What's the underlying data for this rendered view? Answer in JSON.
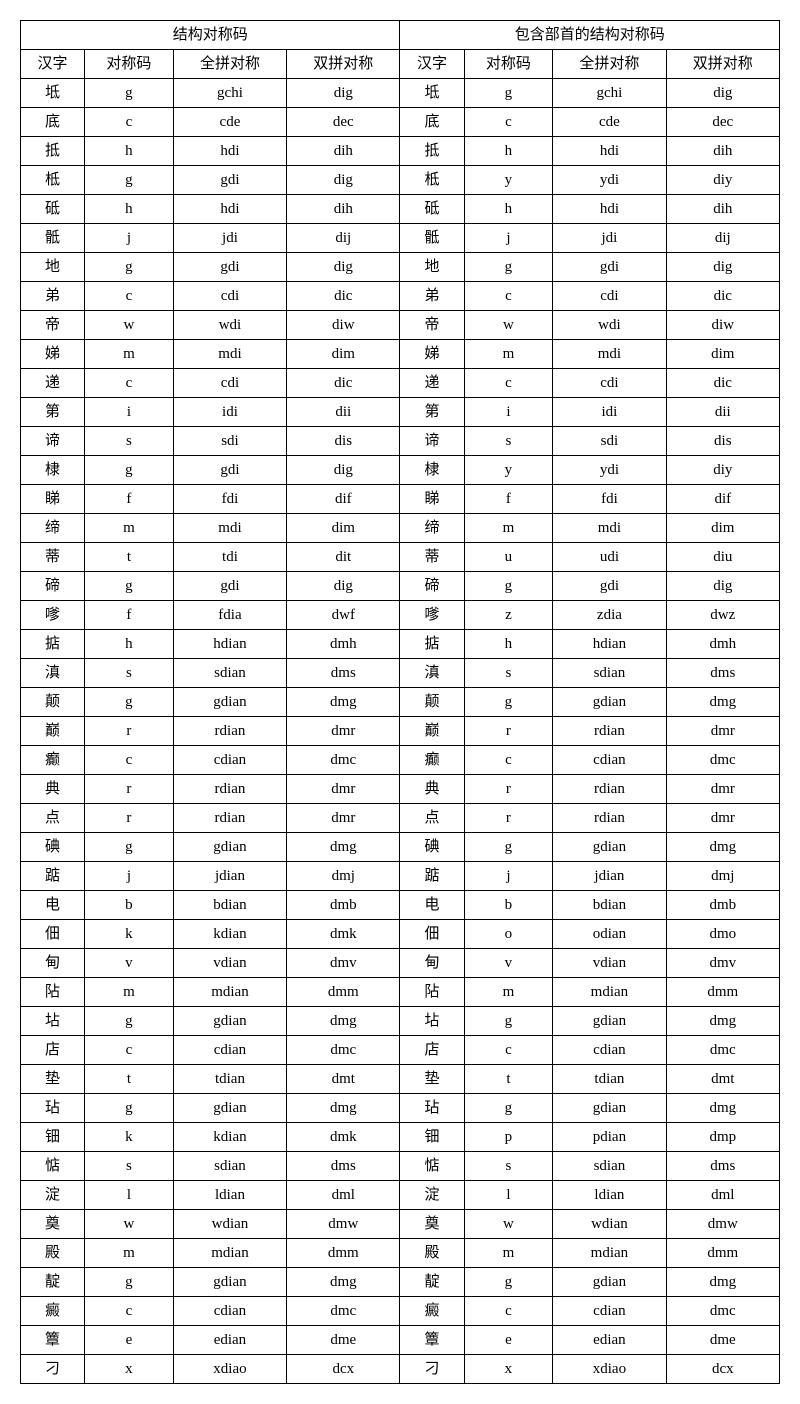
{
  "headers": {
    "group1": "结构对称码",
    "group2": "包含部首的结构对称码",
    "hanzi": "汉字",
    "duichen": "对称码",
    "quanpin": "全拼对称",
    "shuangpin": "双拼对称"
  },
  "rows": [
    {
      "l": {
        "hz": "坻",
        "dc": "g",
        "qp": "gchi",
        "sp": "dig"
      },
      "r": {
        "hz": "坻",
        "dc": "g",
        "qp": "gchi",
        "sp": "dig"
      }
    },
    {
      "l": {
        "hz": "底",
        "dc": "c",
        "qp": "cde",
        "sp": "dec"
      },
      "r": {
        "hz": "底",
        "dc": "c",
        "qp": "cde",
        "sp": "dec"
      }
    },
    {
      "l": {
        "hz": "抵",
        "dc": "h",
        "qp": "hdi",
        "sp": "dih"
      },
      "r": {
        "hz": "抵",
        "dc": "h",
        "qp": "hdi",
        "sp": "dih"
      }
    },
    {
      "l": {
        "hz": "柢",
        "dc": "g",
        "qp": "gdi",
        "sp": "dig"
      },
      "r": {
        "hz": "柢",
        "dc": "y",
        "qp": "ydi",
        "sp": "diy"
      }
    },
    {
      "l": {
        "hz": "砥",
        "dc": "h",
        "qp": "hdi",
        "sp": "dih"
      },
      "r": {
        "hz": "砥",
        "dc": "h",
        "qp": "hdi",
        "sp": "dih"
      }
    },
    {
      "l": {
        "hz": "骶",
        "dc": "j",
        "qp": "jdi",
        "sp": "dij"
      },
      "r": {
        "hz": "骶",
        "dc": "j",
        "qp": "jdi",
        "sp": "dij"
      }
    },
    {
      "l": {
        "hz": "地",
        "dc": "g",
        "qp": "gdi",
        "sp": "dig"
      },
      "r": {
        "hz": "地",
        "dc": "g",
        "qp": "gdi",
        "sp": "dig"
      }
    },
    {
      "l": {
        "hz": "弟",
        "dc": "c",
        "qp": "cdi",
        "sp": "dic"
      },
      "r": {
        "hz": "弟",
        "dc": "c",
        "qp": "cdi",
        "sp": "dic"
      }
    },
    {
      "l": {
        "hz": "帝",
        "dc": "w",
        "qp": "wdi",
        "sp": "diw"
      },
      "r": {
        "hz": "帝",
        "dc": "w",
        "qp": "wdi",
        "sp": "diw"
      }
    },
    {
      "l": {
        "hz": "娣",
        "dc": "m",
        "qp": "mdi",
        "sp": "dim"
      },
      "r": {
        "hz": "娣",
        "dc": "m",
        "qp": "mdi",
        "sp": "dim"
      }
    },
    {
      "l": {
        "hz": "递",
        "dc": "c",
        "qp": "cdi",
        "sp": "dic"
      },
      "r": {
        "hz": "递",
        "dc": "c",
        "qp": "cdi",
        "sp": "dic"
      }
    },
    {
      "l": {
        "hz": "第",
        "dc": "i",
        "qp": "idi",
        "sp": "dii"
      },
      "r": {
        "hz": "第",
        "dc": "i",
        "qp": "idi",
        "sp": "dii"
      }
    },
    {
      "l": {
        "hz": "谛",
        "dc": "s",
        "qp": "sdi",
        "sp": "dis"
      },
      "r": {
        "hz": "谛",
        "dc": "s",
        "qp": "sdi",
        "sp": "dis"
      }
    },
    {
      "l": {
        "hz": "棣",
        "dc": "g",
        "qp": "gdi",
        "sp": "dig"
      },
      "r": {
        "hz": "棣",
        "dc": "y",
        "qp": "ydi",
        "sp": "diy"
      }
    },
    {
      "l": {
        "hz": "睇",
        "dc": "f",
        "qp": "fdi",
        "sp": "dif"
      },
      "r": {
        "hz": "睇",
        "dc": "f",
        "qp": "fdi",
        "sp": "dif"
      }
    },
    {
      "l": {
        "hz": "缔",
        "dc": "m",
        "qp": "mdi",
        "sp": "dim"
      },
      "r": {
        "hz": "缔",
        "dc": "m",
        "qp": "mdi",
        "sp": "dim"
      }
    },
    {
      "l": {
        "hz": "蒂",
        "dc": "t",
        "qp": "tdi",
        "sp": "dit"
      },
      "r": {
        "hz": "蒂",
        "dc": "u",
        "qp": "udi",
        "sp": "diu"
      }
    },
    {
      "l": {
        "hz": "碲",
        "dc": "g",
        "qp": "gdi",
        "sp": "dig"
      },
      "r": {
        "hz": "碲",
        "dc": "g",
        "qp": "gdi",
        "sp": "dig"
      }
    },
    {
      "l": {
        "hz": "嗲",
        "dc": "f",
        "qp": "fdia",
        "sp": "dwf"
      },
      "r": {
        "hz": "嗲",
        "dc": "z",
        "qp": "zdia",
        "sp": "dwz"
      }
    },
    {
      "l": {
        "hz": "掂",
        "dc": "h",
        "qp": "hdian",
        "sp": "dmh"
      },
      "r": {
        "hz": "掂",
        "dc": "h",
        "qp": "hdian",
        "sp": "dmh"
      }
    },
    {
      "l": {
        "hz": "滇",
        "dc": "s",
        "qp": "sdian",
        "sp": "dms"
      },
      "r": {
        "hz": "滇",
        "dc": "s",
        "qp": "sdian",
        "sp": "dms"
      }
    },
    {
      "l": {
        "hz": "颠",
        "dc": "g",
        "qp": "gdian",
        "sp": "dmg"
      },
      "r": {
        "hz": "颠",
        "dc": "g",
        "qp": "gdian",
        "sp": "dmg"
      }
    },
    {
      "l": {
        "hz": "巅",
        "dc": "r",
        "qp": "rdian",
        "sp": "dmr"
      },
      "r": {
        "hz": "巅",
        "dc": "r",
        "qp": "rdian",
        "sp": "dmr"
      }
    },
    {
      "l": {
        "hz": "癫",
        "dc": "c",
        "qp": "cdian",
        "sp": "dmc"
      },
      "r": {
        "hz": "癫",
        "dc": "c",
        "qp": "cdian",
        "sp": "dmc"
      }
    },
    {
      "l": {
        "hz": "典",
        "dc": "r",
        "qp": "rdian",
        "sp": "dmr"
      },
      "r": {
        "hz": "典",
        "dc": "r",
        "qp": "rdian",
        "sp": "dmr"
      }
    },
    {
      "l": {
        "hz": "点",
        "dc": "r",
        "qp": "rdian",
        "sp": "dmr"
      },
      "r": {
        "hz": "点",
        "dc": "r",
        "qp": "rdian",
        "sp": "dmr"
      }
    },
    {
      "l": {
        "hz": "碘",
        "dc": "g",
        "qp": "gdian",
        "sp": "dmg"
      },
      "r": {
        "hz": "碘",
        "dc": "g",
        "qp": "gdian",
        "sp": "dmg"
      }
    },
    {
      "l": {
        "hz": "踮",
        "dc": "j",
        "qp": "jdian",
        "sp": "dmj"
      },
      "r": {
        "hz": "踮",
        "dc": "j",
        "qp": "jdian",
        "sp": "dmj"
      }
    },
    {
      "l": {
        "hz": "电",
        "dc": "b",
        "qp": "bdian",
        "sp": "dmb"
      },
      "r": {
        "hz": "电",
        "dc": "b",
        "qp": "bdian",
        "sp": "dmb"
      }
    },
    {
      "l": {
        "hz": "佃",
        "dc": "k",
        "qp": "kdian",
        "sp": "dmk"
      },
      "r": {
        "hz": "佃",
        "dc": "o",
        "qp": "odian",
        "sp": "dmo"
      }
    },
    {
      "l": {
        "hz": "甸",
        "dc": "v",
        "qp": "vdian",
        "sp": "dmv"
      },
      "r": {
        "hz": "甸",
        "dc": "v",
        "qp": "vdian",
        "sp": "dmv"
      }
    },
    {
      "l": {
        "hz": "阽",
        "dc": "m",
        "qp": "mdian",
        "sp": "dmm"
      },
      "r": {
        "hz": "阽",
        "dc": "m",
        "qp": "mdian",
        "sp": "dmm"
      }
    },
    {
      "l": {
        "hz": "坫",
        "dc": "g",
        "qp": "gdian",
        "sp": "dmg"
      },
      "r": {
        "hz": "坫",
        "dc": "g",
        "qp": "gdian",
        "sp": "dmg"
      }
    },
    {
      "l": {
        "hz": "店",
        "dc": "c",
        "qp": "cdian",
        "sp": "dmc"
      },
      "r": {
        "hz": "店",
        "dc": "c",
        "qp": "cdian",
        "sp": "dmc"
      }
    },
    {
      "l": {
        "hz": "垫",
        "dc": "t",
        "qp": "tdian",
        "sp": "dmt"
      },
      "r": {
        "hz": "垫",
        "dc": "t",
        "qp": "tdian",
        "sp": "dmt"
      }
    },
    {
      "l": {
        "hz": "玷",
        "dc": "g",
        "qp": "gdian",
        "sp": "dmg"
      },
      "r": {
        "hz": "玷",
        "dc": "g",
        "qp": "gdian",
        "sp": "dmg"
      }
    },
    {
      "l": {
        "hz": "钿",
        "dc": "k",
        "qp": "kdian",
        "sp": "dmk"
      },
      "r": {
        "hz": "钿",
        "dc": "p",
        "qp": "pdian",
        "sp": "dmp"
      }
    },
    {
      "l": {
        "hz": "惦",
        "dc": "s",
        "qp": "sdian",
        "sp": "dms"
      },
      "r": {
        "hz": "惦",
        "dc": "s",
        "qp": "sdian",
        "sp": "dms"
      }
    },
    {
      "l": {
        "hz": "淀",
        "dc": "l",
        "qp": "ldian",
        "sp": "dml"
      },
      "r": {
        "hz": "淀",
        "dc": "l",
        "qp": "ldian",
        "sp": "dml"
      }
    },
    {
      "l": {
        "hz": "奠",
        "dc": "w",
        "qp": "wdian",
        "sp": "dmw"
      },
      "r": {
        "hz": "奠",
        "dc": "w",
        "qp": "wdian",
        "sp": "dmw"
      }
    },
    {
      "l": {
        "hz": "殿",
        "dc": "m",
        "qp": "mdian",
        "sp": "dmm"
      },
      "r": {
        "hz": "殿",
        "dc": "m",
        "qp": "mdian",
        "sp": "dmm"
      }
    },
    {
      "l": {
        "hz": "靛",
        "dc": "g",
        "qp": "gdian",
        "sp": "dmg"
      },
      "r": {
        "hz": "靛",
        "dc": "g",
        "qp": "gdian",
        "sp": "dmg"
      }
    },
    {
      "l": {
        "hz": "癜",
        "dc": "c",
        "qp": "cdian",
        "sp": "dmc"
      },
      "r": {
        "hz": "癜",
        "dc": "c",
        "qp": "cdian",
        "sp": "dmc"
      }
    },
    {
      "l": {
        "hz": "簟",
        "dc": "e",
        "qp": "edian",
        "sp": "dme"
      },
      "r": {
        "hz": "簟",
        "dc": "e",
        "qp": "edian",
        "sp": "dme"
      }
    },
    {
      "l": {
        "hz": "刁",
        "dc": "x",
        "qp": "xdiao",
        "sp": "dcx"
      },
      "r": {
        "hz": "刁",
        "dc": "x",
        "qp": "xdiao",
        "sp": "dcx"
      }
    }
  ]
}
